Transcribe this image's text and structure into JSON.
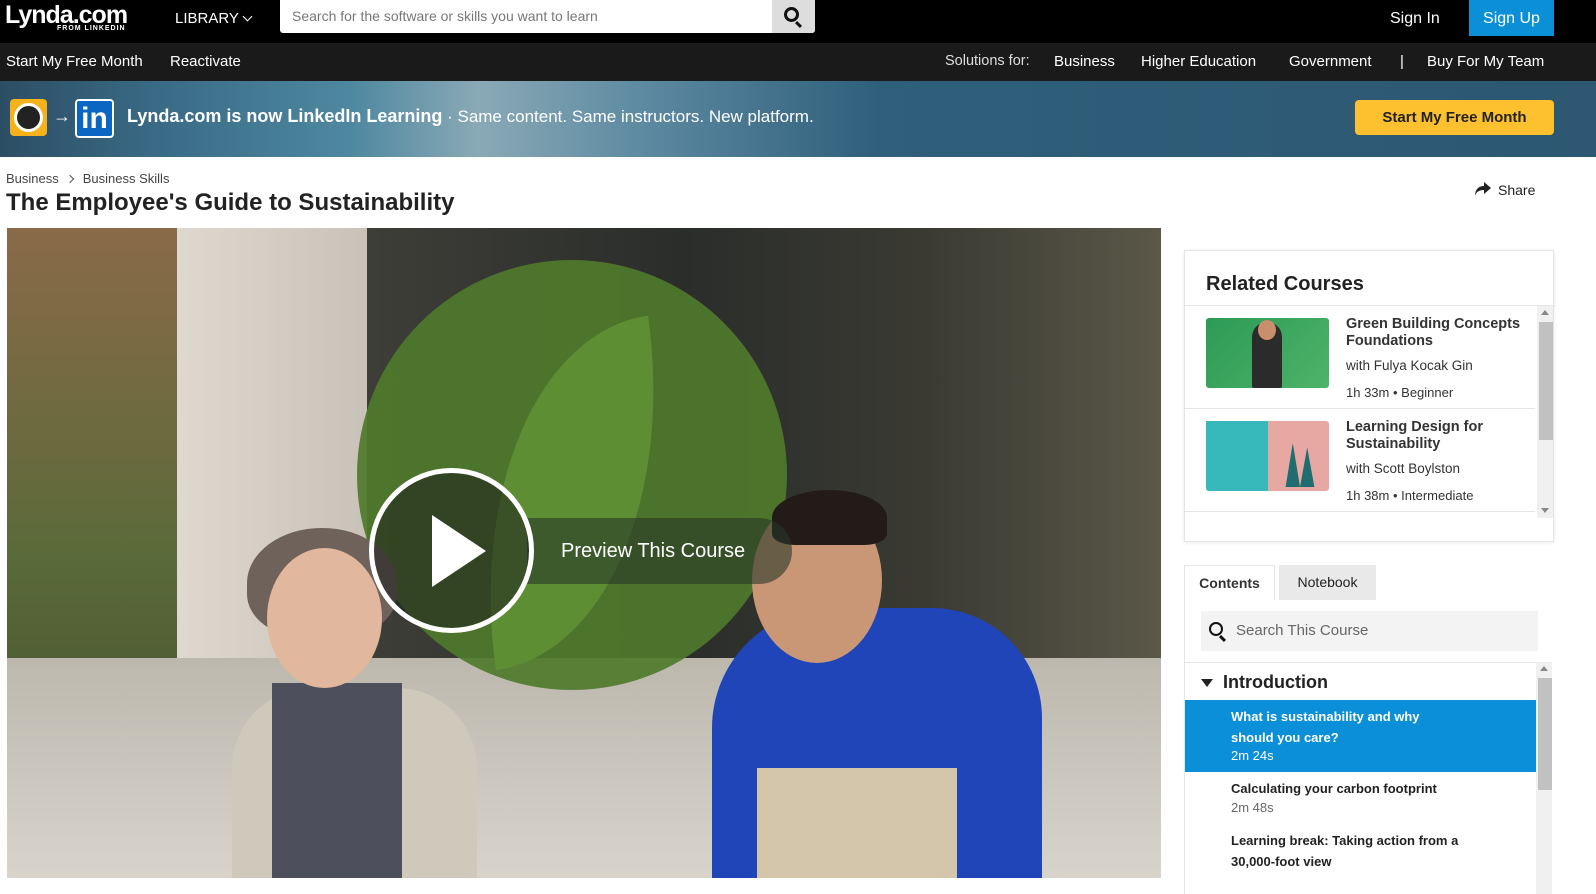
{
  "header": {
    "logo_main": "Lynda.com",
    "logo_sub": "FROM LINKEDIN",
    "library_label": "LIBRARY",
    "search_placeholder": "Search for the software or skills you want to learn",
    "sign_in": "Sign In",
    "sign_up": "Sign Up"
  },
  "subnav": {
    "left": [
      "Start My Free Month",
      "Reactivate"
    ],
    "solutions_label": "Solutions for:",
    "solutions": [
      "Business",
      "Higher Education",
      "Government"
    ],
    "divider": "|",
    "buy": "Buy For My Team"
  },
  "banner": {
    "arrow": "→",
    "in_logo": "in",
    "headline": "Lynda.com is now LinkedIn Learning",
    "tagline": " · Same content. Same instructors. New platform.",
    "cta": "Start My Free Month"
  },
  "breadcrumb": [
    "Business",
    "Business Skills"
  ],
  "page_title": "The Employee's Guide to Sustainability",
  "share_label": "Share",
  "video": {
    "preview_label": "Preview This Course"
  },
  "related": {
    "heading": "Related Courses",
    "items": [
      {
        "title": "Green Building Concepts Foundations",
        "author": "with Fulya Kocak Gin",
        "duration": "1h 33m",
        "level": "Beginner"
      },
      {
        "title": "Learning Design for Sustainability",
        "author": "with Scott Boylston",
        "duration": "1h 38m",
        "level": "Intermediate"
      }
    ]
  },
  "tabs": [
    "Contents",
    "Notebook"
  ],
  "contents": {
    "search_placeholder": "Search This Course",
    "chapter": "Introduction",
    "lessons": [
      {
        "title": "What is sustainability and why should you care?",
        "duration": "2m 24s"
      },
      {
        "title": "Calculating your carbon footprint",
        "duration": "2m 48s"
      },
      {
        "title": "Learning break: Taking action from a 30,000-foot view",
        "duration": ""
      }
    ]
  },
  "colors": {
    "accent_blue": "#0a8fd8",
    "cta_yellow": "#fdc02f",
    "topbar": "#000000"
  }
}
